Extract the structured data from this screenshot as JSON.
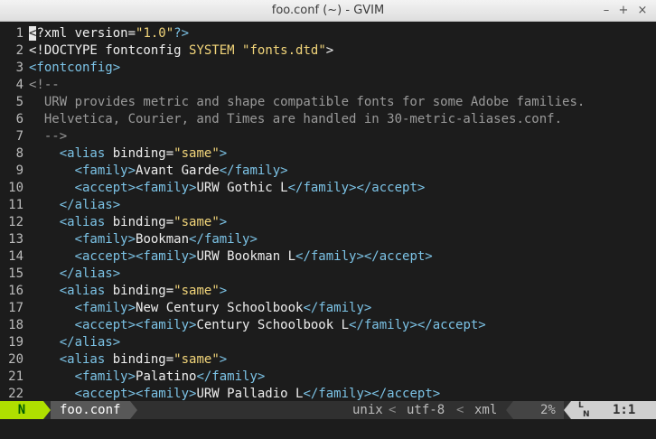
{
  "window": {
    "title": "foo.conf (~) - GVIM",
    "buttons": {
      "minimize": "–",
      "maximize": "+",
      "close": "×"
    }
  },
  "editor": {
    "lines": [
      {
        "n": "1",
        "segs": [
          {
            "t": "<",
            "c": "cursor"
          },
          {
            "t": "?xml version=",
            "c": "attr"
          },
          {
            "t": "\"1.0\"",
            "c": "str"
          },
          {
            "t": "?>",
            "c": "tag"
          }
        ]
      },
      {
        "n": "2",
        "segs": [
          {
            "t": "<!DOCTYPE fontconfig ",
            "c": "doctype"
          },
          {
            "t": "SYSTEM",
            "c": "kw"
          },
          {
            "t": " ",
            "c": "text"
          },
          {
            "t": "\"fonts.dtd\"",
            "c": "str"
          },
          {
            "t": ">",
            "c": "doctype"
          }
        ]
      },
      {
        "n": "3",
        "segs": [
          {
            "t": "<fontconfig>",
            "c": "tag"
          }
        ]
      },
      {
        "n": "4",
        "segs": [
          {
            "t": "<!--",
            "c": "comment"
          }
        ]
      },
      {
        "n": "5",
        "segs": [
          {
            "t": "  URW provides metric and shape compatible fonts for some Adobe families.",
            "c": "comment"
          }
        ]
      },
      {
        "n": "6",
        "segs": [
          {
            "t": "  Helvetica, Courier, and Times are handled in 30-metric-aliases.conf.",
            "c": "comment"
          }
        ]
      },
      {
        "n": "7",
        "segs": [
          {
            "t": "  -->",
            "c": "comment"
          }
        ]
      },
      {
        "n": "8",
        "segs": [
          {
            "t": "    ",
            "c": "text"
          },
          {
            "t": "<alias ",
            "c": "tag"
          },
          {
            "t": "binding=",
            "c": "attr"
          },
          {
            "t": "\"same\"",
            "c": "str"
          },
          {
            "t": ">",
            "c": "tag"
          }
        ]
      },
      {
        "n": "9",
        "segs": [
          {
            "t": "      ",
            "c": "text"
          },
          {
            "t": "<family>",
            "c": "tag"
          },
          {
            "t": "Avant Garde",
            "c": "text"
          },
          {
            "t": "</family>",
            "c": "tag"
          }
        ]
      },
      {
        "n": "10",
        "segs": [
          {
            "t": "      ",
            "c": "text"
          },
          {
            "t": "<accept><family>",
            "c": "tag"
          },
          {
            "t": "URW Gothic L",
            "c": "text"
          },
          {
            "t": "</family></accept>",
            "c": "tag"
          }
        ]
      },
      {
        "n": "11",
        "segs": [
          {
            "t": "    ",
            "c": "text"
          },
          {
            "t": "</alias>",
            "c": "tag"
          }
        ]
      },
      {
        "n": "12",
        "segs": [
          {
            "t": "    ",
            "c": "text"
          },
          {
            "t": "<alias ",
            "c": "tag"
          },
          {
            "t": "binding=",
            "c": "attr"
          },
          {
            "t": "\"same\"",
            "c": "str"
          },
          {
            "t": ">",
            "c": "tag"
          }
        ]
      },
      {
        "n": "13",
        "segs": [
          {
            "t": "      ",
            "c": "text"
          },
          {
            "t": "<family>",
            "c": "tag"
          },
          {
            "t": "Bookman",
            "c": "text"
          },
          {
            "t": "</family>",
            "c": "tag"
          }
        ]
      },
      {
        "n": "14",
        "segs": [
          {
            "t": "      ",
            "c": "text"
          },
          {
            "t": "<accept><family>",
            "c": "tag"
          },
          {
            "t": "URW Bookman L",
            "c": "text"
          },
          {
            "t": "</family></accept>",
            "c": "tag"
          }
        ]
      },
      {
        "n": "15",
        "segs": [
          {
            "t": "    ",
            "c": "text"
          },
          {
            "t": "</alias>",
            "c": "tag"
          }
        ]
      },
      {
        "n": "16",
        "segs": [
          {
            "t": "    ",
            "c": "text"
          },
          {
            "t": "<alias ",
            "c": "tag"
          },
          {
            "t": "binding=",
            "c": "attr"
          },
          {
            "t": "\"same\"",
            "c": "str"
          },
          {
            "t": ">",
            "c": "tag"
          }
        ]
      },
      {
        "n": "17",
        "segs": [
          {
            "t": "      ",
            "c": "text"
          },
          {
            "t": "<family>",
            "c": "tag"
          },
          {
            "t": "New Century Schoolbook",
            "c": "text"
          },
          {
            "t": "</family>",
            "c": "tag"
          }
        ]
      },
      {
        "n": "18",
        "segs": [
          {
            "t": "      ",
            "c": "text"
          },
          {
            "t": "<accept><family>",
            "c": "tag"
          },
          {
            "t": "Century Schoolbook L",
            "c": "text"
          },
          {
            "t": "</family></accept>",
            "c": "tag"
          }
        ]
      },
      {
        "n": "19",
        "segs": [
          {
            "t": "    ",
            "c": "text"
          },
          {
            "t": "</alias>",
            "c": "tag"
          }
        ]
      },
      {
        "n": "20",
        "segs": [
          {
            "t": "    ",
            "c": "text"
          },
          {
            "t": "<alias ",
            "c": "tag"
          },
          {
            "t": "binding=",
            "c": "attr"
          },
          {
            "t": "\"same\"",
            "c": "str"
          },
          {
            "t": ">",
            "c": "tag"
          }
        ]
      },
      {
        "n": "21",
        "segs": [
          {
            "t": "      ",
            "c": "text"
          },
          {
            "t": "<family>",
            "c": "tag"
          },
          {
            "t": "Palatino",
            "c": "text"
          },
          {
            "t": "</family>",
            "c": "tag"
          }
        ]
      },
      {
        "n": "22",
        "segs": [
          {
            "t": "      ",
            "c": "text"
          },
          {
            "t": "<accept><family>",
            "c": "tag"
          },
          {
            "t": "URW Palladio L",
            "c": "text"
          },
          {
            "t": "</family></accept>",
            "c": "tag"
          }
        ]
      }
    ]
  },
  "statusline": {
    "mode": "N",
    "filename": "foo.conf",
    "fileformat": "unix",
    "separator": "<",
    "encoding": "utf-8",
    "filetype": "xml",
    "percent": "2%",
    "line_icon": "LN",
    "position": "1:1"
  },
  "colors": {
    "mode_bg": "#afdf00",
    "tag": "#7cc3e6",
    "string": "#f2d57a",
    "comment": "#9a9a9a",
    "background": "#1c1c1c"
  }
}
